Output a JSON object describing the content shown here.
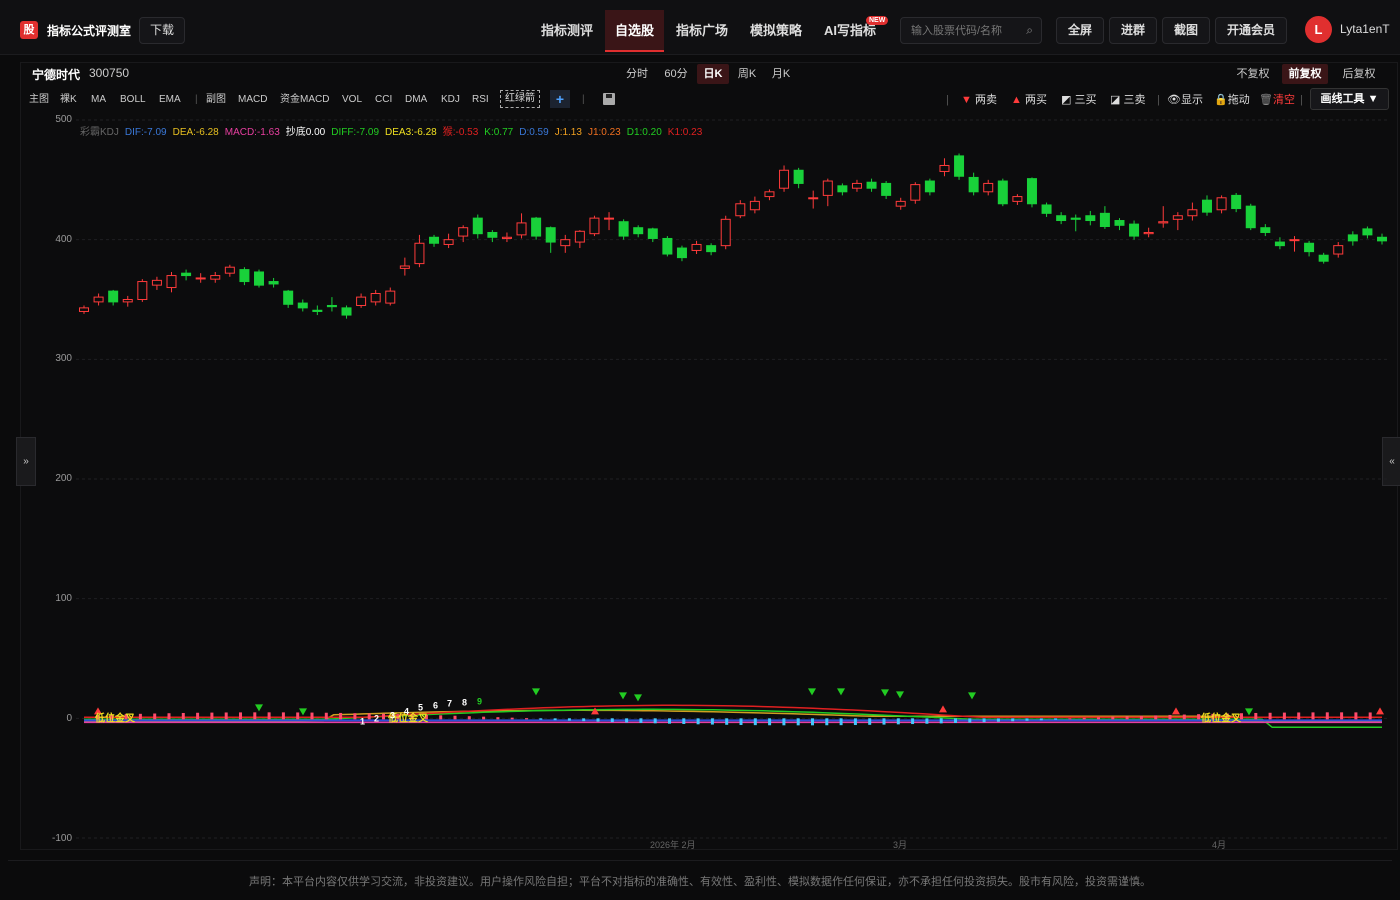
{
  "header": {
    "logo_text": "股",
    "brand": "指标公式评测室",
    "download": "下载",
    "nav": [
      "指标测评",
      "自选股",
      "指标广场",
      "模拟策略",
      "AI写指标"
    ],
    "new_badge": "NEW",
    "search_placeholder": "输入股票代码/名称",
    "buttons": [
      "全屏",
      "进群",
      "截图",
      "开通会员"
    ],
    "avatar_letter": "L",
    "username": "Lyta1enT"
  },
  "stock": {
    "name": "宁德时代",
    "code": "300750"
  },
  "periods": [
    "分时",
    "60分",
    "日K",
    "周K",
    "月K"
  ],
  "fuquan": [
    "不复权",
    "前复权",
    "后复权"
  ],
  "indicators_main": [
    "主图",
    "裸K",
    "MA",
    "BOLL",
    "EMA"
  ],
  "indicators_sub": [
    "副图",
    "MACD",
    "资金MACD",
    "VOL",
    "CCI",
    "DMA",
    "KDJ",
    "RSI"
  ],
  "redgreen_label": "红绿箭",
  "tools": [
    "两卖",
    "两买",
    "三买",
    "三卖",
    "显示",
    "拖动",
    "清空"
  ],
  "draw_tool": "画线工具 ▼",
  "side_left": "»",
  "side_right": "«",
  "legend": [
    {
      "text": "彩霸KDJ",
      "color": "#666666"
    },
    {
      "text": "DIF:-7.09",
      "color": "#3a78d8"
    },
    {
      "text": "DEA:-6.28",
      "color": "#e8c020"
    },
    {
      "text": "MACD:-1.63",
      "color": "#e83fa0"
    },
    {
      "text": "抄底0.00",
      "color": "#ffffff"
    },
    {
      "text": "DIFF:-7.09",
      "color": "#22cc22"
    },
    {
      "text": "DEA3:-6.28",
      "color": "#f0e020"
    },
    {
      "text": "猴:-0.53",
      "color": "#e02020"
    },
    {
      "text": "K:0.77",
      "color": "#22cc22"
    },
    {
      "text": "D:0.59",
      "color": "#3a78d8"
    },
    {
      "text": "J:1.13",
      "color": "#f0a020"
    },
    {
      "text": "J1:0.23",
      "color": "#f07020"
    },
    {
      "text": "D1:0.20",
      "color": "#22cc22"
    },
    {
      "text": "K1:0.23",
      "color": "#e02020"
    }
  ],
  "annotations": {
    "low_golden_cross": "低位金叉",
    "seq": [
      "1",
      "2",
      "3",
      "4",
      "5",
      "6",
      "7",
      "8",
      "9"
    ]
  },
  "x_labels": [
    "2026年 2月",
    "3月",
    "4月"
  ],
  "disclaimer": "声明：本平台内容仅供学习交流，非投资建议。用户操作风险自担；平台不对指标的准确性、有效性、盈利性、模拟数据作任何保证，亦不承担任何投资损失。股市有风险，投资需谨慎。",
  "chart_data": {
    "type": "candlestick",
    "y_ticks": [
      "500",
      "400",
      "300",
      "200",
      "100",
      "0",
      "-100"
    ],
    "ylim": [
      -100,
      500
    ],
    "x": [
      "2026年 2月",
      "3月",
      "4月"
    ],
    "grid": true,
    "colors": {
      "up": "#ff3b3b",
      "down": "#19d13a"
    },
    "candles": [
      {
        "o": 340,
        "c": 343,
        "h": 345,
        "l": 338
      },
      {
        "o": 348,
        "c": 352,
        "h": 355,
        "l": 345
      },
      {
        "o": 357,
        "c": 348,
        "h": 358,
        "l": 345
      },
      {
        "o": 348,
        "c": 350,
        "h": 353,
        "l": 344
      },
      {
        "o": 350,
        "c": 365,
        "h": 367,
        "l": 348
      },
      {
        "o": 362,
        "c": 366,
        "h": 369,
        "l": 358
      },
      {
        "o": 360,
        "c": 370,
        "h": 373,
        "l": 356
      },
      {
        "o": 372,
        "c": 370,
        "h": 375,
        "l": 366
      },
      {
        "o": 368,
        "c": 368,
        "h": 372,
        "l": 364
      },
      {
        "o": 367,
        "c": 370,
        "h": 373,
        "l": 364
      },
      {
        "o": 372,
        "c": 377,
        "h": 379,
        "l": 369
      },
      {
        "o": 375,
        "c": 365,
        "h": 377,
        "l": 362
      },
      {
        "o": 373,
        "c": 362,
        "h": 375,
        "l": 360
      },
      {
        "o": 365,
        "c": 363,
        "h": 368,
        "l": 360
      },
      {
        "o": 357,
        "c": 346,
        "h": 358,
        "l": 343
      },
      {
        "o": 347,
        "c": 343,
        "h": 350,
        "l": 340
      },
      {
        "o": 341,
        "c": 340,
        "h": 345,
        "l": 337
      },
      {
        "o": 345,
        "c": 344,
        "h": 352,
        "l": 340
      },
      {
        "o": 343,
        "c": 337,
        "h": 345,
        "l": 334
      },
      {
        "o": 345,
        "c": 352,
        "h": 355,
        "l": 343
      },
      {
        "o": 348,
        "c": 355,
        "h": 358,
        "l": 345
      },
      {
        "o": 347,
        "c": 357,
        "h": 360,
        "l": 345
      },
      {
        "o": 376,
        "c": 378,
        "h": 385,
        "l": 370
      },
      {
        "o": 380,
        "c": 397,
        "h": 404,
        "l": 377
      },
      {
        "o": 402,
        "c": 397,
        "h": 404,
        "l": 394
      },
      {
        "o": 396,
        "c": 400,
        "h": 405,
        "l": 393
      },
      {
        "o": 403,
        "c": 410,
        "h": 412,
        "l": 398
      },
      {
        "o": 418,
        "c": 405,
        "h": 421,
        "l": 401
      },
      {
        "o": 406,
        "c": 402,
        "h": 408,
        "l": 398
      },
      {
        "o": 401,
        "c": 402,
        "h": 406,
        "l": 398
      },
      {
        "o": 404,
        "c": 414,
        "h": 422,
        "l": 401
      },
      {
        "o": 418,
        "c": 403,
        "h": 419,
        "l": 400
      },
      {
        "o": 410,
        "c": 398,
        "h": 411,
        "l": 389
      },
      {
        "o": 395,
        "c": 400,
        "h": 404,
        "l": 389
      },
      {
        "o": 398,
        "c": 407,
        "h": 408,
        "l": 393
      },
      {
        "o": 405,
        "c": 418,
        "h": 420,
        "l": 403
      },
      {
        "o": 418,
        "c": 418,
        "h": 423,
        "l": 408
      },
      {
        "o": 415,
        "c": 403,
        "h": 417,
        "l": 400
      },
      {
        "o": 410,
        "c": 405,
        "h": 412,
        "l": 402
      },
      {
        "o": 409,
        "c": 401,
        "h": 410,
        "l": 398
      },
      {
        "o": 401,
        "c": 388,
        "h": 403,
        "l": 386
      },
      {
        "o": 393,
        "c": 385,
        "h": 395,
        "l": 382
      },
      {
        "o": 391,
        "c": 396,
        "h": 399,
        "l": 388
      },
      {
        "o": 395,
        "c": 390,
        "h": 397,
        "l": 387
      },
      {
        "o": 395,
        "c": 417,
        "h": 420,
        "l": 392
      },
      {
        "o": 420,
        "c": 430,
        "h": 433,
        "l": 418
      },
      {
        "o": 425,
        "c": 432,
        "h": 436,
        "l": 422
      },
      {
        "o": 436,
        "c": 440,
        "h": 442,
        "l": 433
      },
      {
        "o": 443,
        "c": 458,
        "h": 462,
        "l": 440
      },
      {
        "o": 458,
        "c": 447,
        "h": 460,
        "l": 443
      },
      {
        "o": 435,
        "c": 435,
        "h": 441,
        "l": 426
      },
      {
        "o": 437,
        "c": 449,
        "h": 451,
        "l": 428
      },
      {
        "o": 445,
        "c": 440,
        "h": 447,
        "l": 437
      },
      {
        "o": 443,
        "c": 447,
        "h": 450,
        "l": 440
      },
      {
        "o": 448,
        "c": 443,
        "h": 451,
        "l": 440
      },
      {
        "o": 447,
        "c": 437,
        "h": 449,
        "l": 434
      },
      {
        "o": 428,
        "c": 432,
        "h": 435,
        "l": 425
      },
      {
        "o": 433,
        "c": 446,
        "h": 448,
        "l": 430
      },
      {
        "o": 449,
        "c": 440,
        "h": 451,
        "l": 437
      },
      {
        "o": 457,
        "c": 462,
        "h": 468,
        "l": 453
      },
      {
        "o": 470,
        "c": 453,
        "h": 472,
        "l": 450
      },
      {
        "o": 452,
        "c": 440,
        "h": 456,
        "l": 437
      },
      {
        "o": 440,
        "c": 447,
        "h": 450,
        "l": 437
      },
      {
        "o": 449,
        "c": 430,
        "h": 451,
        "l": 428
      },
      {
        "o": 432,
        "c": 436,
        "h": 438,
        "l": 429
      },
      {
        "o": 451,
        "c": 430,
        "h": 452,
        "l": 427
      },
      {
        "o": 429,
        "c": 422,
        "h": 431,
        "l": 419
      },
      {
        "o": 420,
        "c": 416,
        "h": 423,
        "l": 413
      },
      {
        "o": 418,
        "c": 417,
        "h": 421,
        "l": 407
      },
      {
        "o": 420,
        "c": 416,
        "h": 424,
        "l": 412
      },
      {
        "o": 422,
        "c": 411,
        "h": 428,
        "l": 409
      },
      {
        "o": 416,
        "c": 412,
        "h": 418,
        "l": 408
      },
      {
        "o": 413,
        "c": 403,
        "h": 416,
        "l": 400
      },
      {
        "o": 405,
        "c": 406,
        "h": 410,
        "l": 402
      },
      {
        "o": 414,
        "c": 415,
        "h": 428,
        "l": 410
      },
      {
        "o": 417,
        "c": 420,
        "h": 423,
        "l": 408
      },
      {
        "o": 420,
        "c": 425,
        "h": 431,
        "l": 416
      },
      {
        "o": 433,
        "c": 423,
        "h": 437,
        "l": 420
      },
      {
        "o": 425,
        "c": 435,
        "h": 437,
        "l": 422
      },
      {
        "o": 437,
        "c": 426,
        "h": 439,
        "l": 423
      },
      {
        "o": 428,
        "c": 410,
        "h": 430,
        "l": 408
      },
      {
        "o": 410,
        "c": 406,
        "h": 413,
        "l": 403
      },
      {
        "o": 398,
        "c": 395,
        "h": 402,
        "l": 392
      },
      {
        "o": 400,
        "c": 400,
        "h": 403,
        "l": 390
      },
      {
        "o": 397,
        "c": 390,
        "h": 399,
        "l": 386
      },
      {
        "o": 387,
        "c": 382,
        "h": 389,
        "l": 380
      },
      {
        "o": 388,
        "c": 395,
        "h": 398,
        "l": 385
      },
      {
        "o": 404,
        "c": 399,
        "h": 407,
        "l": 395
      },
      {
        "o": 409,
        "c": 404,
        "h": 411,
        "l": 401
      },
      {
        "o": 402,
        "c": 399,
        "h": 405,
        "l": 396
      }
    ]
  }
}
